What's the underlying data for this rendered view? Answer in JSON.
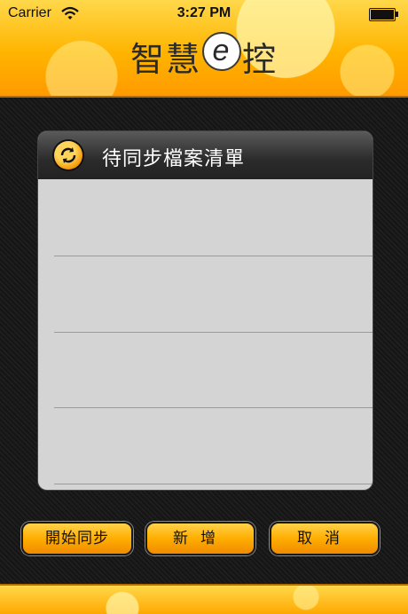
{
  "status_bar": {
    "carrier": "Carrier",
    "time": "3:27 PM",
    "wifi_icon": "wifi-icon",
    "battery_icon": "battery-icon"
  },
  "header": {
    "logo_left": "智慧",
    "logo_e": "e",
    "logo_right": "控"
  },
  "panel": {
    "icon": "sync-icon",
    "title": "待同步檔案清單",
    "rows": [
      "",
      "",
      "",
      ""
    ]
  },
  "buttons": {
    "sync_label": "開始同步",
    "add_label": "新增",
    "cancel_label": "取消"
  },
  "colors": {
    "accent": "#ffb400",
    "panel_bg": "#d4d4d4",
    "panel_head": "#2b2b2b"
  }
}
